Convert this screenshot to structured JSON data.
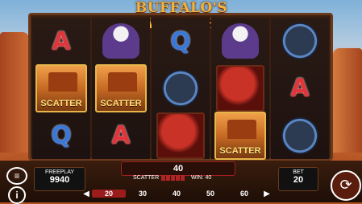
{
  "title": "BUFFALO'S WEALTH",
  "reels": [
    [
      {
        "kind": "letter",
        "text": "A",
        "cls": "A"
      },
      {
        "kind": "scatter",
        "text": "SCATTER"
      },
      {
        "kind": "letter",
        "text": "Q",
        "cls": "Q"
      }
    ],
    [
      {
        "kind": "eagle"
      },
      {
        "kind": "scatter",
        "text": "SCATTER"
      },
      {
        "kind": "letter",
        "text": "A",
        "cls": "A"
      }
    ],
    [
      {
        "kind": "letter",
        "text": "Q",
        "cls": "Q"
      },
      {
        "kind": "panther"
      },
      {
        "kind": "horse"
      }
    ],
    [
      {
        "kind": "eagle"
      },
      {
        "kind": "horse"
      },
      {
        "kind": "scatter",
        "text": "SCATTER"
      }
    ],
    [
      {
        "kind": "panther"
      },
      {
        "kind": "letter",
        "text": "A",
        "cls": "A"
      },
      {
        "kind": "panther"
      }
    ]
  ],
  "freeplay": {
    "label": "FREEPLAY",
    "value": "9940"
  },
  "win_display": "40",
  "status": {
    "scatter_label": "SCATTER",
    "win_text": "WIN: 40"
  },
  "bet": {
    "label": "BET",
    "value": "20"
  },
  "bet_options": [
    "20",
    "30",
    "40",
    "50",
    "60"
  ],
  "selected_bet": "20",
  "icons": {
    "menu": "menu-icon",
    "info": "info-icon",
    "spin": "spin-icon"
  }
}
